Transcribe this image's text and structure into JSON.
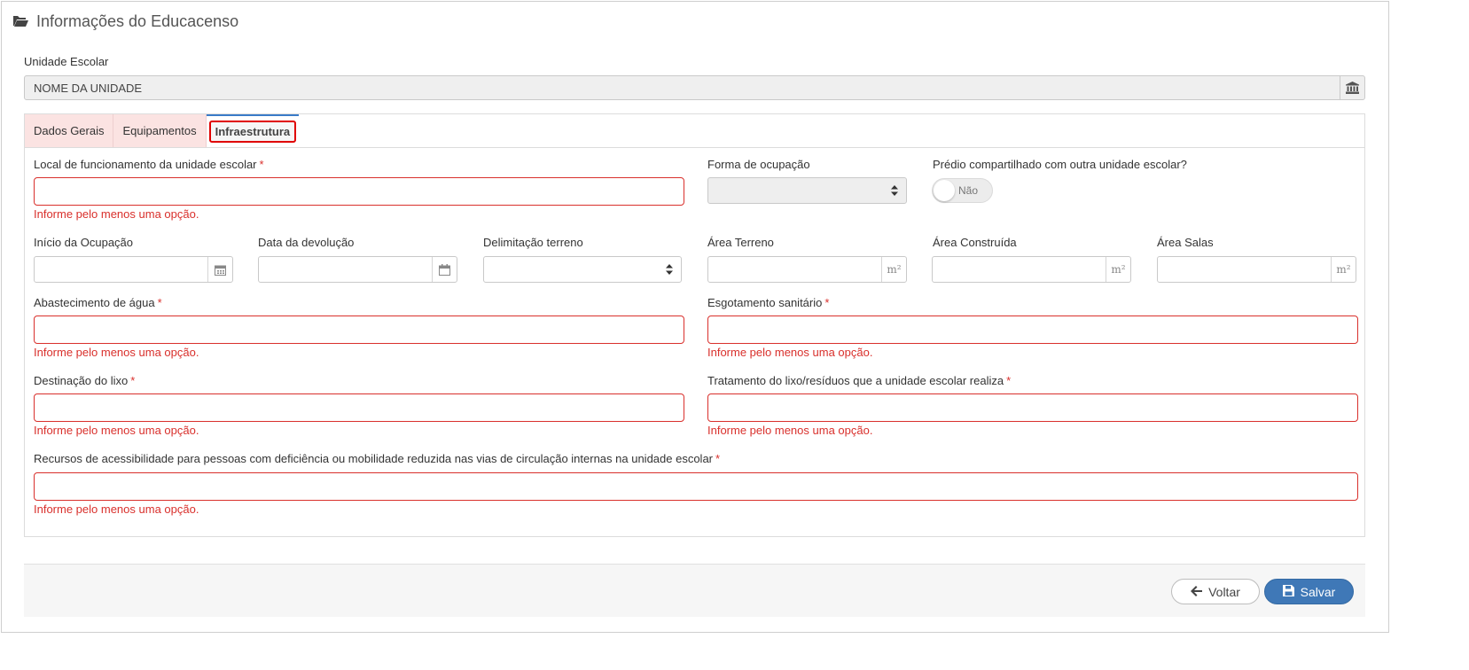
{
  "header": {
    "title": "Informações do Educacenso",
    "icon": "folder-open-icon"
  },
  "unit": {
    "label": "Unidade Escolar",
    "value": "NOME DA UNIDADE",
    "icon": "bank-icon"
  },
  "tabs": [
    {
      "label": "Dados Gerais",
      "active": false
    },
    {
      "label": "Equipamentos",
      "active": false
    },
    {
      "label": "Infraestrutura",
      "active": true
    }
  ],
  "form": {
    "error_message": "Informe pelo menos uma opção.",
    "local_funcionamento": {
      "label": "Local de funcionamento da unidade escolar",
      "required": "*"
    },
    "forma_ocupacao": {
      "label": "Forma de ocupação",
      "value": ""
    },
    "predio_compartilhado": {
      "label": "Prédio compartilhado com outra unidade escolar?",
      "value": "Não"
    },
    "inicio_ocupacao": {
      "label": "Início da Ocupação",
      "value": ""
    },
    "data_devolucao": {
      "label": "Data da devolução",
      "value": ""
    },
    "delimitacao_terreno": {
      "label": "Delimitação terreno",
      "value": ""
    },
    "area_terreno": {
      "label": "Área Terreno",
      "unit": "m²"
    },
    "area_construida": {
      "label": "Área Construída",
      "unit": "m²"
    },
    "area_salas": {
      "label": "Área Salas",
      "unit": "m²"
    },
    "abastecimento_agua": {
      "label": "Abastecimento de água",
      "required": "*"
    },
    "esgotamento_sanitario": {
      "label": "Esgotamento sanitário",
      "required": "*"
    },
    "destinacao_lixo": {
      "label": "Destinação do lixo",
      "required": "*"
    },
    "tratamento_lixo": {
      "label": "Tratamento do lixo/resíduos que a unidade escolar realiza",
      "required": "*"
    },
    "recursos_acessibilidade": {
      "label": "Recursos de acessibilidade para pessoas com deficiência ou mobilidade reduzida nas vias de circulação internas na unidade escolar",
      "required": "*"
    }
  },
  "footer": {
    "back_label": "Voltar",
    "save_label": "Salvar"
  },
  "colors": {
    "error": "#d9302c",
    "primary": "#3f78b7",
    "tab_inactive_bg": "#fbe3e2",
    "highlight": "#e00000"
  }
}
